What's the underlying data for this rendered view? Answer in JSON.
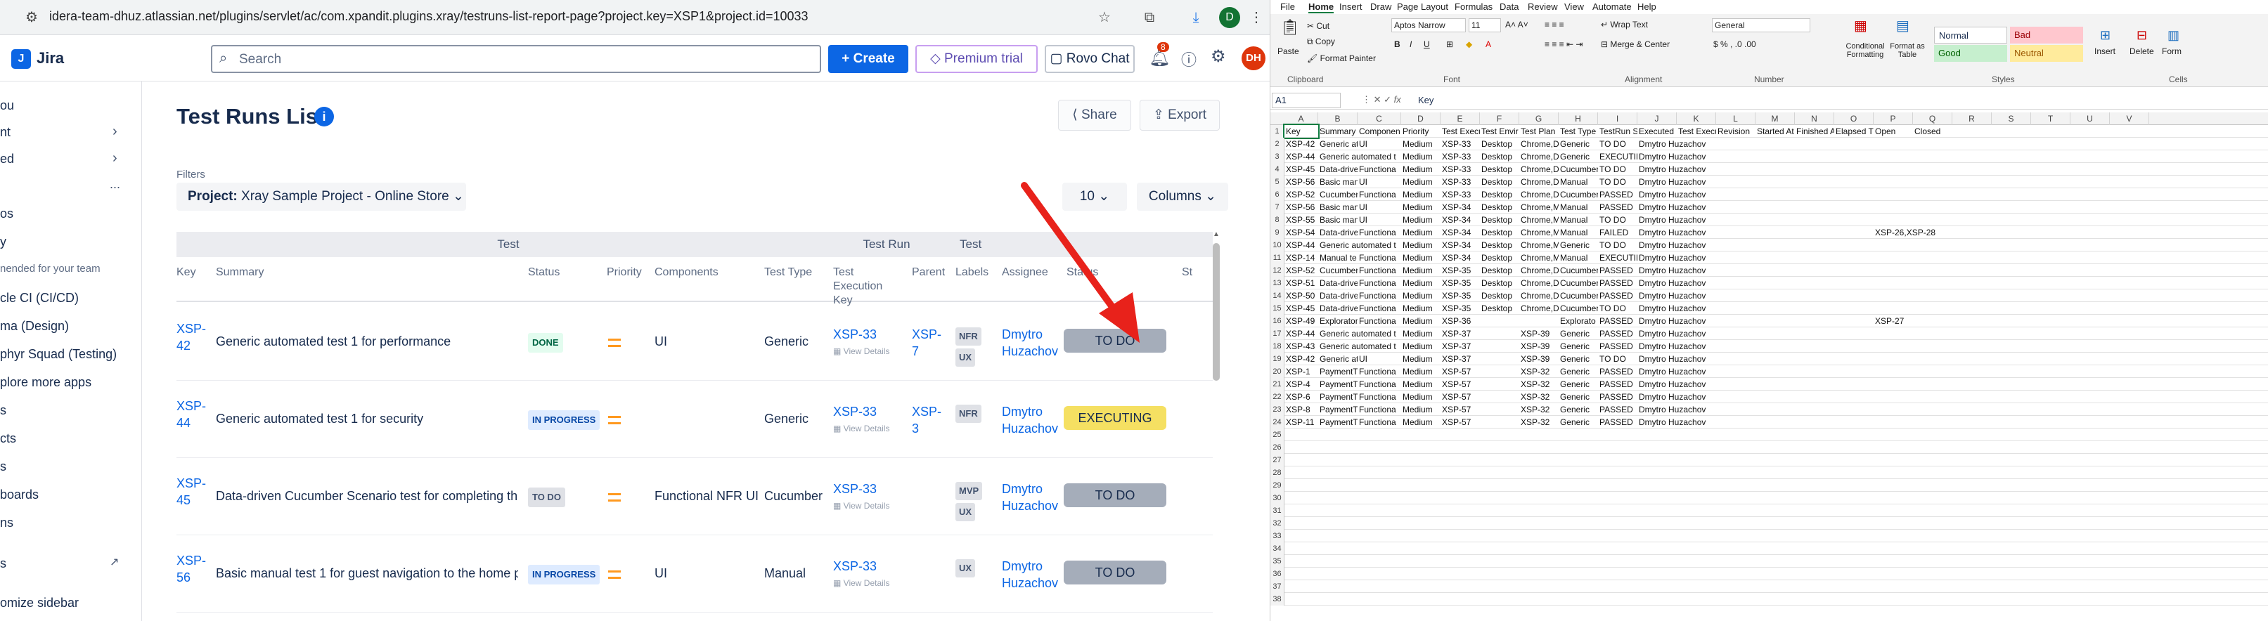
{
  "browser": {
    "url": "idera-team-dhuz.atlassian.net/plugins/servlet/ac/com.xpandit.plugins.xray/testruns-list-report-page?project.key=XSP1&project.id=10033",
    "profile_initial": "D"
  },
  "jira": {
    "app_name": "Jira",
    "search_placeholder": "Search",
    "create_label": "Create",
    "premium_label": "Premium trial",
    "rovo_label": "Rovo Chat",
    "notif_count": "8",
    "avatar_initials": "DH"
  },
  "sidebar": {
    "items": [
      "ou",
      "nt",
      "ed",
      "...",
      "os",
      "y",
      "nended for your team",
      "cle CI (CI/CD)",
      "ma (Design)",
      "phyr Squad (Testing)",
      "plore more apps",
      "s",
      "cts",
      "s",
      "boards",
      "ns",
      "s",
      "omize sidebar"
    ]
  },
  "page": {
    "title": "Test Runs List",
    "share_label": "Share",
    "export_label": "Export",
    "filters_label": "Filters",
    "project_filter_key": "Project:",
    "project_filter_value": "Xray Sample Project - Online Store",
    "page_size": "10",
    "columns_label": "Columns"
  },
  "table": {
    "groups": [
      "Test",
      "Test Run",
      "Test"
    ],
    "headers": [
      "Key",
      "Summary",
      "Status",
      "Priority",
      "Components",
      "Test Type",
      "Test Execution Key",
      "Parent",
      "Labels",
      "Assignee",
      "Status",
      "St"
    ],
    "view_details": "View Details",
    "rows": [
      {
        "key": "XSP-42",
        "summary": "Generic automated test 1 for performance",
        "status": "DONE",
        "status_class": "done",
        "components": "UI",
        "test_type": "Generic",
        "exec_key": "XSP-33",
        "parent": "XSP-7",
        "labels": [
          "NFR",
          "UX"
        ],
        "assignee": "Dmytro Huzachov",
        "run_status": "TO DO",
        "run_color": "#a5adba"
      },
      {
        "key": "XSP-44",
        "summary": "Generic automated test 1 for security",
        "status": "IN PROGRESS",
        "status_class": "prog",
        "components": "",
        "test_type": "Generic",
        "exec_key": "XSP-33",
        "parent": "XSP-3",
        "labels": [
          "NFR"
        ],
        "assignee": "Dmytro Huzachov",
        "run_status": "EXECUTING",
        "run_color": "#f5e062"
      },
      {
        "key": "XSP-45",
        "summary": "Data-driven Cucumber Scenario test for completing th...",
        "status": "TO DO",
        "status_class": "todo",
        "components": "Functional NFR UI",
        "test_type": "Cucumber",
        "exec_key": "XSP-33",
        "parent": "",
        "labels": [
          "MVP",
          "UX"
        ],
        "assignee": "Dmytro Huzachov",
        "run_status": "TO DO",
        "run_color": "#a5adba"
      },
      {
        "key": "XSP-56",
        "summary": "Basic manual test 1 for guest navigation to the home p...",
        "status": "IN PROGRESS",
        "status_class": "prog",
        "components": "UI",
        "test_type": "Manual",
        "exec_key": "XSP-33",
        "parent": "",
        "labels": [
          "UX"
        ],
        "assignee": "Dmytro Huzachov",
        "run_status": "TO DO",
        "run_color": "#a5adba"
      }
    ]
  },
  "excel": {
    "tabs": [
      "File",
      "Home",
      "Insert",
      "Draw",
      "Page Layout",
      "Formulas",
      "Data",
      "Review",
      "View",
      "Automate",
      "Help"
    ],
    "ribbon": {
      "paste": "Paste",
      "cut": "Cut",
      "copy": "Copy",
      "format_painter": "Format Painter",
      "font_name": "Aptos Narrow",
      "font_size": "11",
      "wrap": "Wrap Text",
      "merge": "Merge & Center",
      "number_format": "General",
      "cond": "Conditional Formatting",
      "fmt_table": "Format as Table",
      "style_normal": "Normal",
      "style_bad": "Bad",
      "style_good": "Good",
      "style_neutral": "Neutral",
      "insert": "Insert",
      "delete": "Delete",
      "format": "Form",
      "groups": [
        "Clipboard",
        "Font",
        "Alignment",
        "Number",
        "Styles",
        "Cells"
      ]
    },
    "name_box": "A1",
    "formula": "Key",
    "columns": [
      "A",
      "B",
      "C",
      "D",
      "E",
      "F",
      "G",
      "H",
      "I",
      "J",
      "K",
      "L",
      "M",
      "N",
      "O",
      "P",
      "Q",
      "R",
      "S",
      "T",
      "U",
      "V"
    ],
    "rows": [
      [
        "Key",
        "Summary",
        "Componen",
        "Priority",
        "Test Execu",
        "Test Envir",
        "Test Plan",
        "Test Type",
        "TestRun St",
        "Executed E",
        "Test Execu",
        "Revision",
        "Started At",
        "Finished A",
        "Elapsed Ti",
        "Open",
        "Closed"
      ],
      [
        "XSP-42",
        "Generic at",
        "UI",
        "Medium",
        "XSP-33",
        "Desktop",
        "Chrome,De",
        "Generic",
        "TO DO",
        "Dmytro Huzachov",
        "",
        "",
        "",
        "",
        "",
        "",
        ""
      ],
      [
        "XSP-44",
        "Generic automated t",
        "",
        "Medium",
        "XSP-33",
        "Desktop",
        "Chrome,De",
        "Generic",
        "EXECUTIN",
        "Dmytro Huzachov",
        "",
        "",
        "",
        "",
        "",
        "",
        ""
      ],
      [
        "XSP-45",
        "Data-drive",
        "Functiona",
        "Medium",
        "XSP-33",
        "Desktop",
        "Chrome,De",
        "Cucumber",
        "TO DO",
        "Dmytro Huzachov",
        "",
        "",
        "",
        "",
        "",
        "",
        ""
      ],
      [
        "XSP-56",
        "Basic man",
        "UI",
        "Medium",
        "XSP-33",
        "Desktop",
        "Chrome,De",
        "Manual",
        "TO DO",
        "Dmytro Huzachov",
        "",
        "",
        "",
        "",
        "",
        "",
        ""
      ],
      [
        "XSP-52",
        "Cucumber",
        "Functiona",
        "Medium",
        "XSP-33",
        "Desktop",
        "Chrome,De",
        "Cucumber",
        "PASSED",
        "Dmytro Huzachov",
        "",
        "",
        "",
        "",
        "",
        "",
        ""
      ],
      [
        "XSP-56",
        "Basic man",
        "UI",
        "Medium",
        "XSP-34",
        "Desktop",
        "Chrome,Mo",
        "Manual",
        "PASSED",
        "Dmytro Huzachov",
        "",
        "",
        "",
        "",
        "",
        "",
        ""
      ],
      [
        "XSP-55",
        "Basic man",
        "UI",
        "Medium",
        "XSP-34",
        "Desktop",
        "Chrome,Mo",
        "Manual",
        "TO DO",
        "Dmytro Huzachov",
        "",
        "",
        "",
        "",
        "",
        "",
        ""
      ],
      [
        "XSP-54",
        "Data-drive",
        "Functiona",
        "Medium",
        "XSP-34",
        "Desktop",
        "Chrome,Mo",
        "Manual",
        "FAILED",
        "Dmytro Huzachov",
        "",
        "",
        "",
        "",
        "",
        "XSP-26,XSP-28",
        ""
      ],
      [
        "XSP-44",
        "Generic automated t",
        "",
        "Medium",
        "XSP-34",
        "Desktop",
        "Chrome,Mo",
        "Generic",
        "TO DO",
        "Dmytro Huzachov",
        "",
        "",
        "",
        "",
        "",
        "",
        ""
      ],
      [
        "XSP-14",
        "Manual te",
        "Functiona",
        "Medium",
        "XSP-34",
        "Desktop",
        "Chrome,Mo",
        "Manual",
        "EXECUTIN",
        "Dmytro Huzachov",
        "",
        "",
        "",
        "",
        "",
        "",
        ""
      ],
      [
        "XSP-52",
        "Cucumber",
        "Functiona",
        "Medium",
        "XSP-35",
        "Desktop",
        "Chrome,De",
        "Cucumber",
        "PASSED",
        "Dmytro Huzachov",
        "",
        "",
        "",
        "",
        "",
        "",
        ""
      ],
      [
        "XSP-51",
        "Data-drive",
        "Functiona",
        "Medium",
        "XSP-35",
        "Desktop",
        "Chrome,De",
        "Cucumber",
        "PASSED",
        "Dmytro Huzachov",
        "",
        "",
        "",
        "",
        "",
        "",
        ""
      ],
      [
        "XSP-50",
        "Data-drive",
        "Functiona",
        "Medium",
        "XSP-35",
        "Desktop",
        "Chrome,De",
        "Cucumber",
        "PASSED",
        "Dmytro Huzachov",
        "",
        "",
        "",
        "",
        "",
        "",
        ""
      ],
      [
        "XSP-45",
        "Data-drive",
        "Functiona",
        "Medium",
        "XSP-35",
        "Desktop",
        "Chrome,De",
        "Cucumber",
        "TO DO",
        "Dmytro Huzachov",
        "",
        "",
        "",
        "",
        "",
        "",
        ""
      ],
      [
        "XSP-49",
        "Explorator",
        "Functiona",
        "Medium",
        "XSP-36",
        "",
        "",
        "Explorato",
        "PASSED",
        "Dmytro Huzachov",
        "",
        "",
        "",
        "",
        "",
        "XSP-27",
        ""
      ],
      [
        "XSP-44",
        "Generic automated t",
        "",
        "Medium",
        "XSP-37",
        "",
        "XSP-39",
        "Generic",
        "PASSED",
        "Dmytro Huzachov",
        "",
        "",
        "",
        "",
        "",
        "",
        ""
      ],
      [
        "XSP-43",
        "Generic automated t",
        "",
        "Medium",
        "XSP-37",
        "",
        "XSP-39",
        "Generic",
        "PASSED",
        "Dmytro Huzachov",
        "",
        "",
        "",
        "",
        "",
        "",
        ""
      ],
      [
        "XSP-42",
        "Generic at",
        "UI",
        "Medium",
        "XSP-37",
        "",
        "XSP-39",
        "Generic",
        "TO DO",
        "Dmytro Huzachov",
        "",
        "",
        "",
        "",
        "",
        "",
        ""
      ],
      [
        "XSP-1",
        "PaymentT",
        "Functiona",
        "Medium",
        "XSP-57",
        "",
        "XSP-32",
        "Generic",
        "PASSED",
        "Dmytro Huzachov",
        "",
        "",
        "",
        "",
        "",
        "",
        ""
      ],
      [
        "XSP-4",
        "PaymentT",
        "Functiona",
        "Medium",
        "XSP-57",
        "",
        "XSP-32",
        "Generic",
        "PASSED",
        "Dmytro Huzachov",
        "",
        "",
        "",
        "",
        "",
        "",
        ""
      ],
      [
        "XSP-6",
        "PaymentT",
        "Functiona",
        "Medium",
        "XSP-57",
        "",
        "XSP-32",
        "Generic",
        "PASSED",
        "Dmytro Huzachov",
        "",
        "",
        "",
        "",
        "",
        "",
        ""
      ],
      [
        "XSP-8",
        "PaymentT",
        "Functiona",
        "Medium",
        "XSP-57",
        "",
        "XSP-32",
        "Generic",
        "PASSED",
        "Dmytro Huzachov",
        "",
        "",
        "",
        "",
        "",
        "",
        ""
      ],
      [
        "XSP-11",
        "PaymentT",
        "Functiona",
        "Medium",
        "XSP-57",
        "",
        "XSP-32",
        "Generic",
        "PASSED",
        "Dmytro Huzachov",
        "",
        "",
        "",
        "",
        "",
        "",
        ""
      ]
    ],
    "row_count": 38
  }
}
